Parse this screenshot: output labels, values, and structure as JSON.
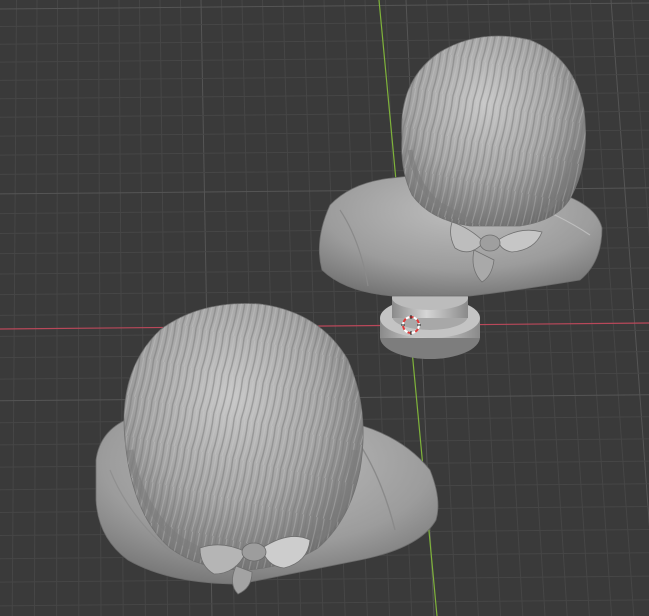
{
  "viewport": {
    "view": "3d-viewport-perspective",
    "background_color": "#3a3a3a",
    "grid_minor_color": "#464646",
    "grid_major_color": "#555555",
    "x_axis_color": "#c84a5a",
    "y_axis_color": "#7fb33a",
    "mesh_color": "#8e8e8e",
    "mesh_highlight_color": "#c6c6c6",
    "mesh_shadow_color": "#575757"
  },
  "objects": [
    {
      "name": "bust-back-with-pedestal",
      "icon": "mesh-object",
      "type": "mesh"
    },
    {
      "name": "bust-back-large-foreground",
      "icon": "mesh-object",
      "type": "mesh"
    }
  ],
  "cursor": {
    "icon": "3d-cursor-icon"
  }
}
